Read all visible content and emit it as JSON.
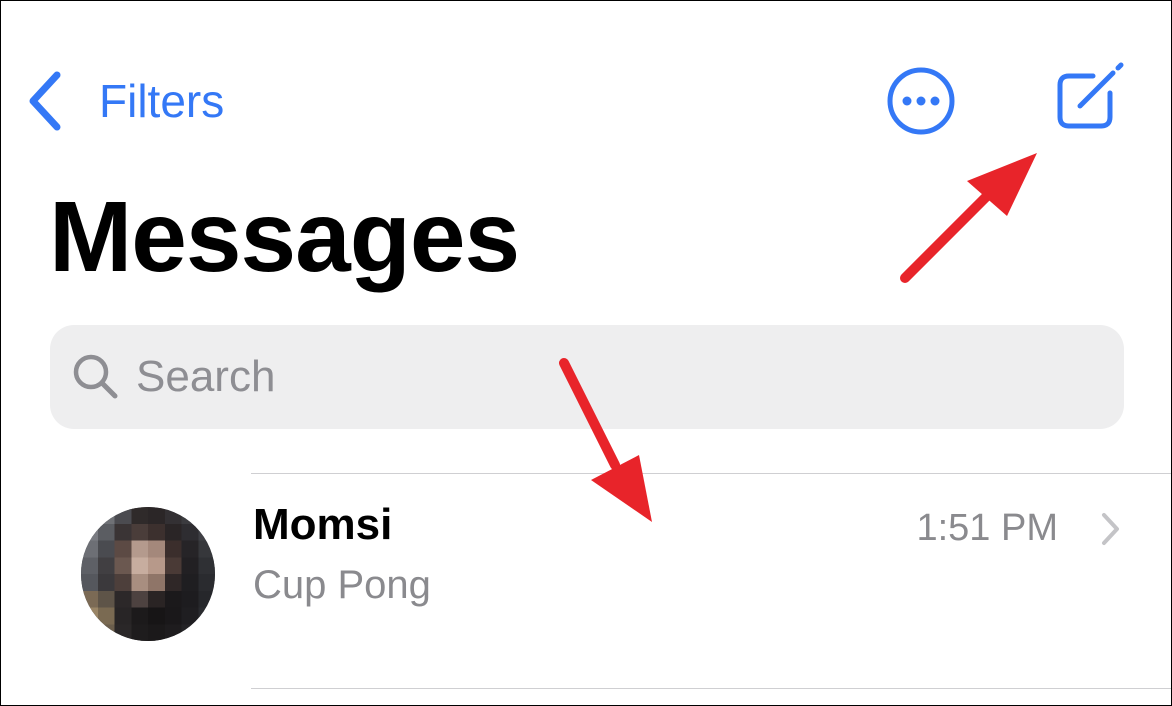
{
  "colors": {
    "accent": "#3478F6",
    "secondary_text": "#8A8A8E",
    "search_background": "#EEEEEF",
    "annotation_arrow": "#E8242A"
  },
  "nav": {
    "back_label": "Filters",
    "back_icon": "chevron-left-icon",
    "more_icon": "ellipsis-circle-icon",
    "compose_icon": "square-pencil-icon"
  },
  "title": "Messages",
  "search": {
    "placeholder": "Search",
    "value": "",
    "icon": "magnifying-glass-icon"
  },
  "conversations": [
    {
      "name": "Momsi",
      "preview": "Cup Pong",
      "time": "1:51 PM",
      "avatar": "pixelated-photo",
      "chevron_icon": "chevron-right-icon"
    }
  ],
  "annotations": [
    {
      "type": "arrow",
      "points_to": "compose-button"
    },
    {
      "type": "arrow",
      "points_to": "conversation-row"
    }
  ]
}
